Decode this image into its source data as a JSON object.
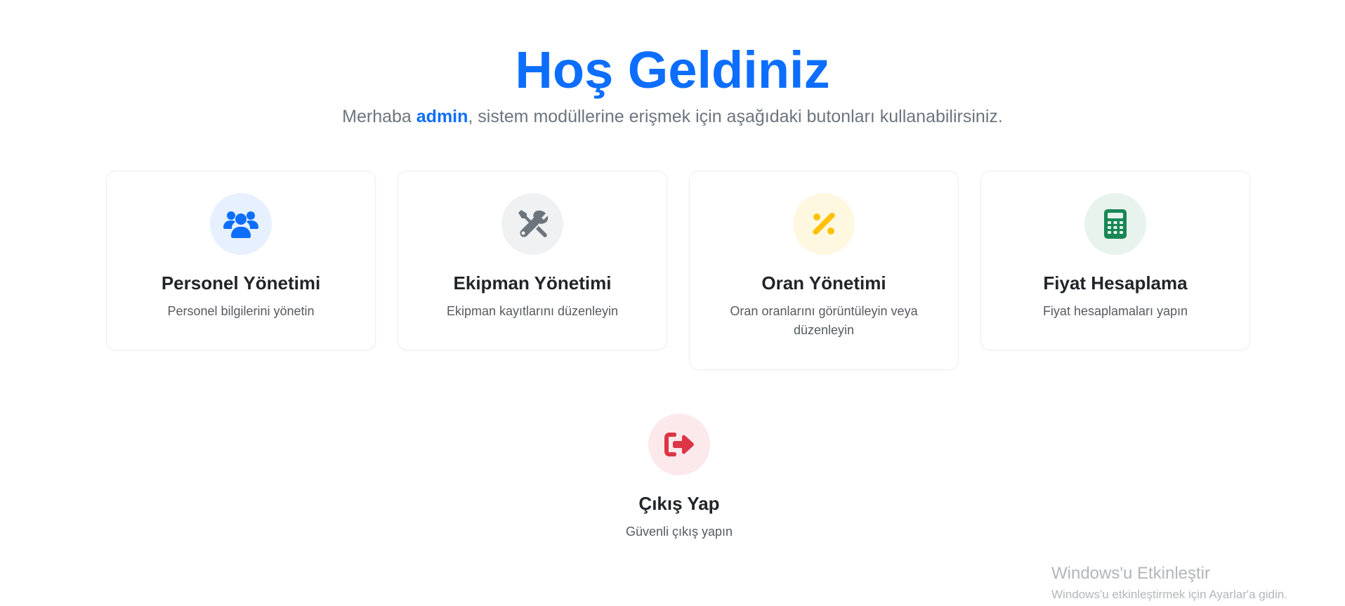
{
  "header": {
    "title": "Hoş Geldiniz",
    "greeting_prefix": "Merhaba ",
    "username": "admin",
    "greeting_suffix": ", sistem modüllerine erişmek için aşağıdaki butonları kullanabilirsiniz."
  },
  "cards": [
    {
      "title": "Personel Yönetimi",
      "description": "Personel bilgilerini yönetin",
      "icon": "users-icon",
      "icon_color": "#0d6efd",
      "icon_bg": "#e7f0fe"
    },
    {
      "title": "Ekipman Yönetimi",
      "description": "Ekipman kayıtlarını düzenleyin",
      "icon": "tools-icon",
      "icon_color": "#6c757d",
      "icon_bg": "#f0f1f2"
    },
    {
      "title": "Oran Yönetimi",
      "description": "Oran oranlarını görüntüleyin veya düzenleyin",
      "icon": "percent-icon",
      "icon_color": "#ffc107",
      "icon_bg": "#fff8e1"
    },
    {
      "title": "Fiyat Hesaplama",
      "description": "Fiyat hesaplamaları yapın",
      "icon": "calculator-icon",
      "icon_color": "#198754",
      "icon_bg": "#e8f3ee"
    }
  ],
  "logout": {
    "title": "Çıkış Yap",
    "description": "Güvenli çıkış yapın",
    "icon": "sign-out-icon",
    "icon_color": "#dc3545",
    "icon_bg": "#fbe9eb"
  },
  "watermark": {
    "title": "Windows'u Etkinleştir",
    "subtitle": "Windows'u etkinleştirmek için Ayarlar'a gidin."
  }
}
